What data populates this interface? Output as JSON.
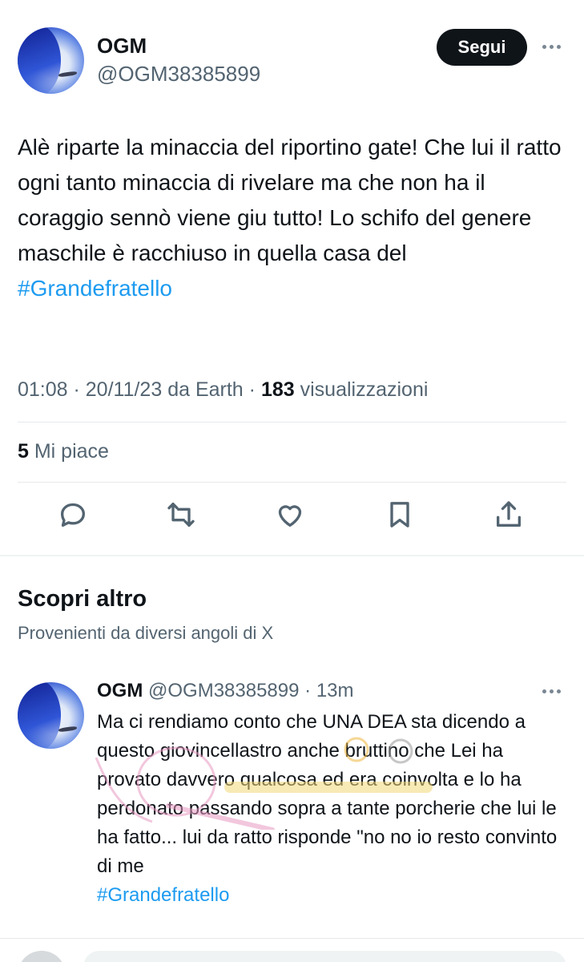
{
  "tweet": {
    "author_name": "OGM",
    "author_handle": "@OGM38385899",
    "follow_label": "Segui",
    "text": "Alè riparte la minaccia del riportino gate! Che lui il ratto ogni tanto minaccia di rivelare ma che non ha il coraggio sennò viene giu tutto! Lo schifo del genere maschile è racchiuso in quella casa del",
    "hashtag": "#Grandefratello",
    "time": "01:08",
    "date": "20/11/23",
    "source": "da Earth",
    "views_count": "183",
    "views_label": "visualizzazioni",
    "likes_count": "5",
    "likes_label": "Mi piace"
  },
  "actions": [
    "reply-icon",
    "retweet-icon",
    "like-icon",
    "bookmark-icon",
    "share-icon"
  ],
  "discover": {
    "title": "Scopri altro",
    "subtitle": "Provenienti da diversi angoli di X"
  },
  "reply": {
    "author_name": "OGM",
    "author_handle": "@OGM38385899",
    "age": "13m",
    "text": "Ma ci rendiamo conto che UNA DEA sta dicendo a questo giovincellastro anche bruttino che Lei ha provato davvero qualcosa ed era coinvolta e lo ha perdonato passando sopra a tante porcherie che lui le ha fatto... lui da ratto risponde \"no no io resto convinto di me",
    "hashtag": "#Grandefratello"
  },
  "colors": {
    "link": "#1d9bf0",
    "secondary_text": "#536471",
    "primary_text": "#0f1419",
    "button_bg": "#0f1419"
  }
}
